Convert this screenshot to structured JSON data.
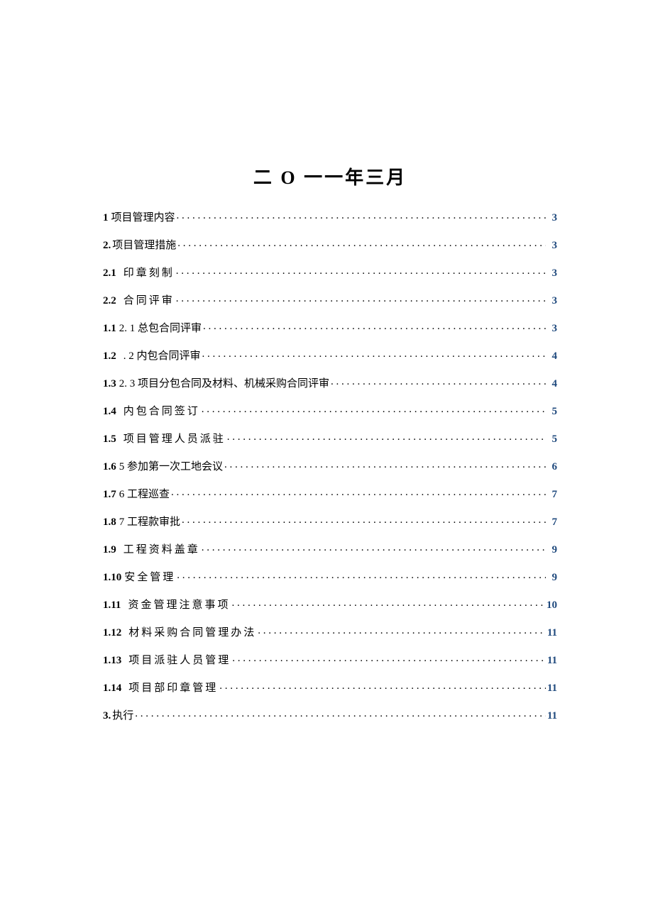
{
  "title": "二 O 一一年三月",
  "toc": [
    {
      "num": "1",
      "text": "项目管理内容",
      "page": "3",
      "numPad": "",
      "textPad": "pad-sm",
      "spaced": false
    },
    {
      "num": "2.",
      "text": "项目管理措施",
      "page": "3",
      "numPad": "",
      "textPad": "",
      "spaced": false
    },
    {
      "num": "2.1",
      "text": "印章刻制",
      "page": "3",
      "numPad": "",
      "textPad": "pad-md",
      "spaced": true
    },
    {
      "num": "2.2",
      "text": "合同评审",
      "page": "3",
      "numPad": "",
      "textPad": "pad-md",
      "spaced": true
    },
    {
      "num": "1.1",
      "text": "2. 1 总包合同评审",
      "page": "3",
      "numPad": "",
      "textPad": "pad-sm",
      "spaced": false
    },
    {
      "num": "1.2",
      "text": ". 2 内包合同评审",
      "page": "4",
      "numPad": "",
      "textPad": "pad-md",
      "spaced": false
    },
    {
      "num": "1.3",
      "text": "2. 3 项目分包合同及材料、机械采购合同评审",
      "page": "4",
      "numPad": "",
      "textPad": "pad-sm",
      "spaced": false
    },
    {
      "num": "1.4",
      "text": "内包合同签订",
      "page": "5",
      "numPad": "",
      "textPad": "pad-md",
      "spaced": true
    },
    {
      "num": "1.5",
      "text": "项目管理人员派驻",
      "page": "5",
      "numPad": "",
      "textPad": "pad-md",
      "spaced": true
    },
    {
      "num": "1.6",
      "text": "5 参加第一次工地会议",
      "page": "6",
      "numPad": "",
      "textPad": "pad-sm",
      "spaced": false
    },
    {
      "num": "1.7",
      "text": "6 工程巡查",
      "page": "7",
      "numPad": "",
      "textPad": "pad-sm",
      "spaced": false
    },
    {
      "num": "1.8",
      "text": "7 工程款审批",
      "page": "7",
      "numPad": "",
      "textPad": "pad-sm",
      "spaced": false
    },
    {
      "num": "1.9",
      "text": "工程资料盖章",
      "page": "9",
      "numPad": "",
      "textPad": "pad-md",
      "spaced": true
    },
    {
      "num": "1.10",
      "text": "安全管理",
      "page": "9",
      "numPad": "",
      "textPad": "pad-sm",
      "spaced": true
    },
    {
      "num": "1.11",
      "text": "资金管理注意事项",
      "page": "10",
      "numPad": "",
      "textPad": "pad-md",
      "spaced": true
    },
    {
      "num": "1.12",
      "text": "材料采购合同管理办法",
      "page": "11",
      "numPad": "",
      "textPad": "pad-md",
      "spaced": true
    },
    {
      "num": "1.13",
      "text": "项目派驻人员管理",
      "page": "11",
      "numPad": "",
      "textPad": "pad-md",
      "spaced": true
    },
    {
      "num": "1.14",
      "text": "项目部印章管理",
      "page": "11",
      "numPad": "",
      "textPad": "pad-md",
      "spaced": true
    },
    {
      "num": "3.",
      "text": "执行",
      "page": "11",
      "numPad": "",
      "textPad": "",
      "spaced": false
    }
  ]
}
